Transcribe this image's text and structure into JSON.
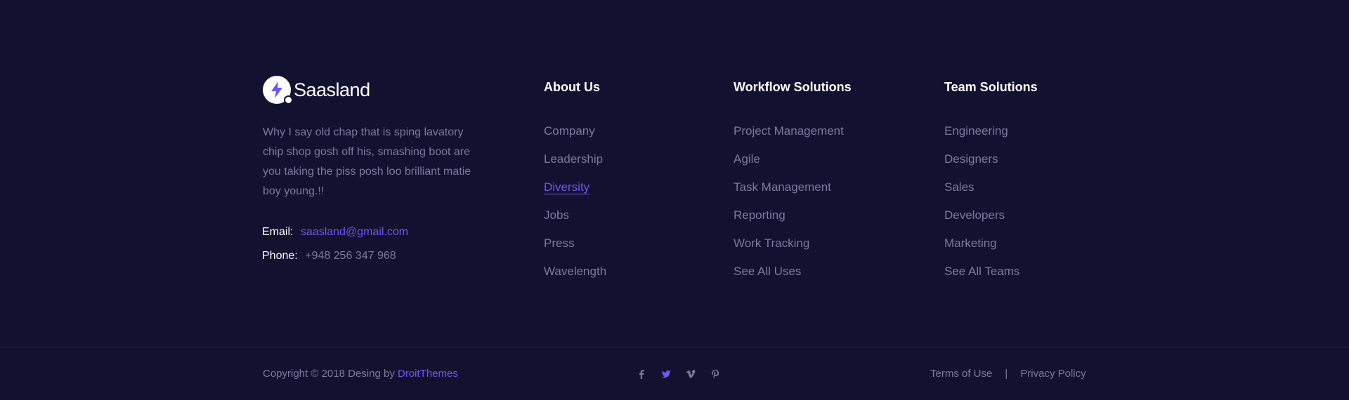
{
  "brand": {
    "name": "Saasland"
  },
  "about": {
    "text": "Why I say old chap that is sping lavatory chip shop gosh off his, smashing boot are you taking the piss posh loo brilliant matie boy young.!!"
  },
  "contact": {
    "email_label": "Email:",
    "email": "saasland@gmail.com",
    "phone_label": "Phone:",
    "phone": "+948 256 347 968"
  },
  "columns": {
    "about": {
      "title": "About Us",
      "items": [
        "Company",
        "Leadership",
        "Diversity",
        "Jobs",
        "Press",
        "Wavelength"
      ],
      "active": "Diversity"
    },
    "workflow": {
      "title": "Workflow Solutions",
      "items": [
        "Project Management",
        "Agile",
        "Task Management",
        "Reporting",
        "Work Tracking",
        "See All Uses"
      ]
    },
    "team": {
      "title": "Team Solutions",
      "items": [
        "Engineering",
        "Designers",
        "Sales",
        "Developers",
        "Marketing",
        "See All Teams"
      ]
    }
  },
  "bottom": {
    "copyright_prefix": "Copyright © 2018 Desing by ",
    "copyright_author": "DroitThemes",
    "social": [
      "facebook-icon",
      "twitter-icon",
      "vimeo-icon",
      "pinterest-icon"
    ],
    "terms": "Terms of Use",
    "separator": "|",
    "privacy": "Privacy Policy"
  },
  "colors": {
    "background": "#131130",
    "accent": "#6e56f0",
    "muted": "#7b7a9c",
    "heading": "#ffffff"
  }
}
